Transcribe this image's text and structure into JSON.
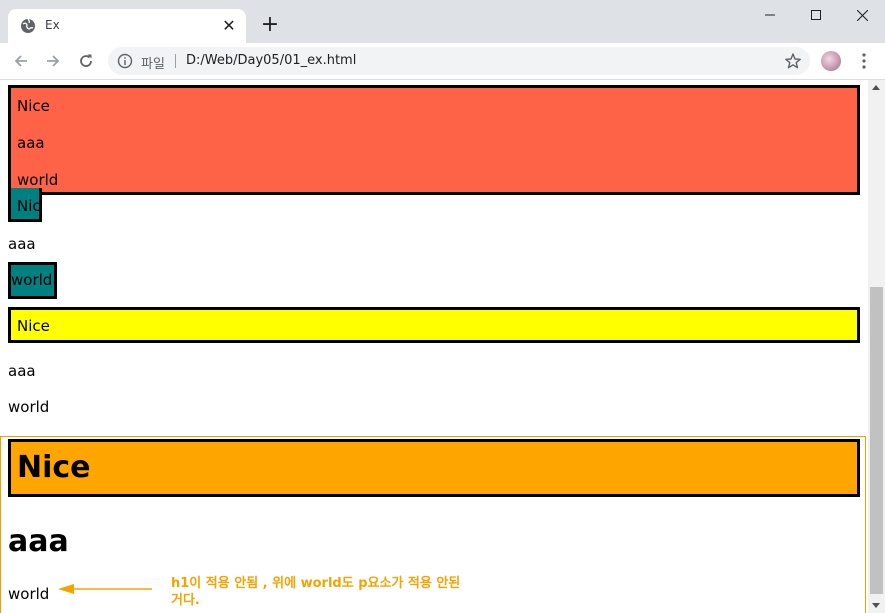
{
  "browser": {
    "tab_title": "Ex",
    "tab_close_glyph": "✕",
    "new_tab_glyph": "+",
    "scheme_label": "파일",
    "url": "D:/Web/Day05/01_ex.html",
    "icons": {
      "favicon": "globe-icon",
      "back": "arrow-left-icon",
      "forward": "arrow-right-icon",
      "reload": "reload-icon",
      "info": "info-icon",
      "bookmark": "star-icon",
      "profile": "avatar",
      "menu": "kebab-menu-icon"
    }
  },
  "page": {
    "box1": {
      "line1": "Nice",
      "line2": "aaa",
      "line3": "world",
      "bg": "#ff6347"
    },
    "teal_nice": "Nice",
    "aaa1": "aaa",
    "teal_world": "world",
    "teal_color": "#008080",
    "yellow_nice": "Nice",
    "yellow_color": "#ffff00",
    "aaa2": "aaa",
    "world2": "world",
    "orange_heading": "Nice",
    "orange_color": "#ffa500",
    "big_aaa": "aaa",
    "last_world": "world"
  },
  "annotation": {
    "note": "h1이 적용 안됨 , 위에 world도 p요소가 적용 안된거다.",
    "color": "#f5a300"
  }
}
